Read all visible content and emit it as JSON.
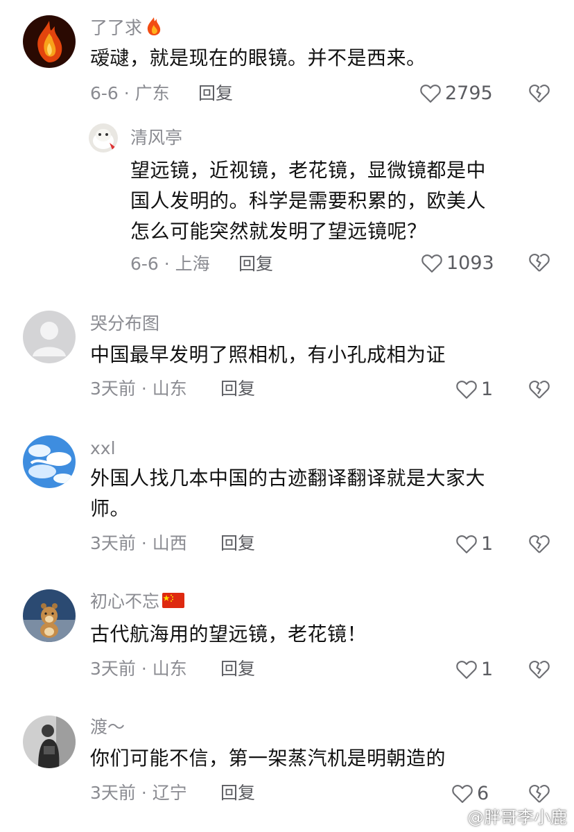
{
  "comments": [
    {
      "username": "了了求",
      "text": "叆叇，就是现在的眼镜。并不是西来。",
      "meta": "6-6 · 广东",
      "reply_label": "回复",
      "likes": "2795"
    },
    {
      "username": "清风亭",
      "text_lines": [
        "望远镜，近视镜，老花镜，显微镜都是中",
        "国人发明的。科学是需要积累的，欧美人",
        "怎么可能突然就发明了望远镜呢？"
      ],
      "meta": "6-6 · 上海",
      "reply_label": "回复",
      "likes": "1093"
    },
    {
      "username": "哭分布图",
      "text": "中国最早发明了照相机，有小孔成相为证",
      "meta": "3天前 · 山东",
      "reply_label": "回复",
      "likes": "1"
    },
    {
      "username": "xxl",
      "text_lines": [
        "外国人找几本中国的古迹翻译翻译就是大家大",
        "师。"
      ],
      "meta": "3天前 · 山西",
      "reply_label": "回复",
      "likes": "1"
    },
    {
      "username": "初心不忘",
      "text": "古代航海用的望远镜，老花镜！",
      "meta": "3天前 · 山东",
      "reply_label": "回复",
      "likes": "1"
    },
    {
      "username": "渡～",
      "text": "你们可能不信，第一架蒸汽机是明朝造的",
      "meta": "3天前 · 辽宁",
      "reply_label": "回复",
      "likes": "6"
    }
  ],
  "watermark": "@胖哥李小鹿",
  "icons": {
    "like": "heart-outline-icon",
    "dislike": "broken-heart-icon",
    "fire": "fire-emoji-icon",
    "flag": "china-flag-icon"
  }
}
